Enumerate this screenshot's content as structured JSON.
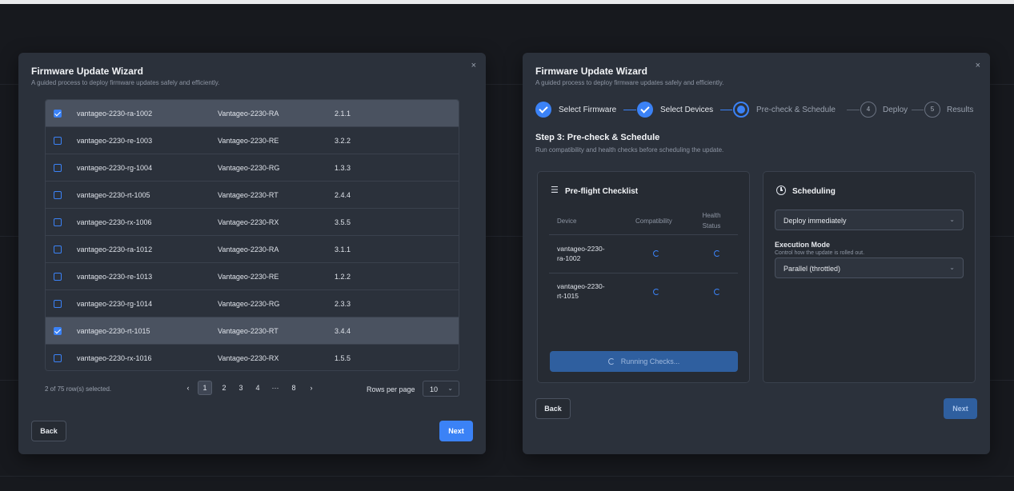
{
  "left_modal": {
    "title": "Firmware Update Wizard",
    "subtitle": "A guided process to deploy firmware updates safely and efficiently.",
    "close": "×",
    "devices": [
      {
        "name": "vantageo-2230-ra-1002",
        "model": "Vantageo-2230-RA",
        "version": "2.1.1",
        "selected": true
      },
      {
        "name": "vantageo-2230-re-1003",
        "model": "Vantageo-2230-RE",
        "version": "3.2.2",
        "selected": false
      },
      {
        "name": "vantageo-2230-rg-1004",
        "model": "Vantageo-2230-RG",
        "version": "1.3.3",
        "selected": false
      },
      {
        "name": "vantageo-2230-rt-1005",
        "model": "Vantageo-2230-RT",
        "version": "2.4.4",
        "selected": false
      },
      {
        "name": "vantageo-2230-rx-1006",
        "model": "Vantageo-2230-RX",
        "version": "3.5.5",
        "selected": false
      },
      {
        "name": "vantageo-2230-ra-1012",
        "model": "Vantageo-2230-RA",
        "version": "3.1.1",
        "selected": false
      },
      {
        "name": "vantageo-2230-re-1013",
        "model": "Vantageo-2230-RE",
        "version": "1.2.2",
        "selected": false
      },
      {
        "name": "vantageo-2230-rg-1014",
        "model": "Vantageo-2230-RG",
        "version": "2.3.3",
        "selected": false
      },
      {
        "name": "vantageo-2230-rt-1015",
        "model": "Vantageo-2230-RT",
        "version": "3.4.4",
        "selected": true
      },
      {
        "name": "vantageo-2230-rx-1016",
        "model": "Vantageo-2230-RX",
        "version": "1.5.5",
        "selected": false
      }
    ],
    "selection_summary": "2 of 75 row(s) selected.",
    "pagination": {
      "prev": "‹",
      "pages": [
        "1",
        "2",
        "3",
        "4",
        "···",
        "8"
      ],
      "active": "1",
      "next": "›"
    },
    "rows_per_page_label": "Rows per page",
    "rows_per_page_value": "10",
    "back_label": "Back",
    "next_label": "Next"
  },
  "right_modal": {
    "title": "Firmware Update Wizard",
    "subtitle": "A guided process to deploy firmware updates safely and efficiently.",
    "close": "×",
    "steps": [
      {
        "label": "Select Firmware",
        "state": "done",
        "num": ""
      },
      {
        "label": "Select Devices",
        "state": "done",
        "num": ""
      },
      {
        "label": "Pre-check & Schedule",
        "state": "current",
        "num": "3"
      },
      {
        "label": "Deploy",
        "state": "todo",
        "num": "4"
      },
      {
        "label": "Results",
        "state": "todo",
        "num": "5"
      }
    ],
    "section_title": "Step 3: Pre-check & Schedule",
    "section_subtitle": "Run compatibility and health checks before scheduling the update.",
    "checklist": {
      "title": "Pre-flight Checklist",
      "icon": "checklist-icon",
      "col_device": "Device",
      "col_compat": "Compatibility",
      "col_health_1": "Health",
      "col_health_2": "Status",
      "rows": [
        {
          "device_1": "vantageo-2230-",
          "device_2": "ra-1002"
        },
        {
          "device_1": "vantageo-2230-",
          "device_2": "rt-1015"
        }
      ],
      "running_label": "Running Checks..."
    },
    "scheduling": {
      "title": "Scheduling",
      "icon": "clock-icon",
      "timing_value": "Deploy immediately",
      "mode_label": "Execution Mode",
      "mode_help": "Control how the update is rolled out.",
      "mode_value": "Parallel (throttled)"
    },
    "back_label": "Back",
    "next_label": "Next"
  },
  "colors": {
    "accent": "#3b82f6",
    "modal_bg": "#2b313b",
    "card_bg": "#262b33",
    "page_bg": "#17191e"
  }
}
